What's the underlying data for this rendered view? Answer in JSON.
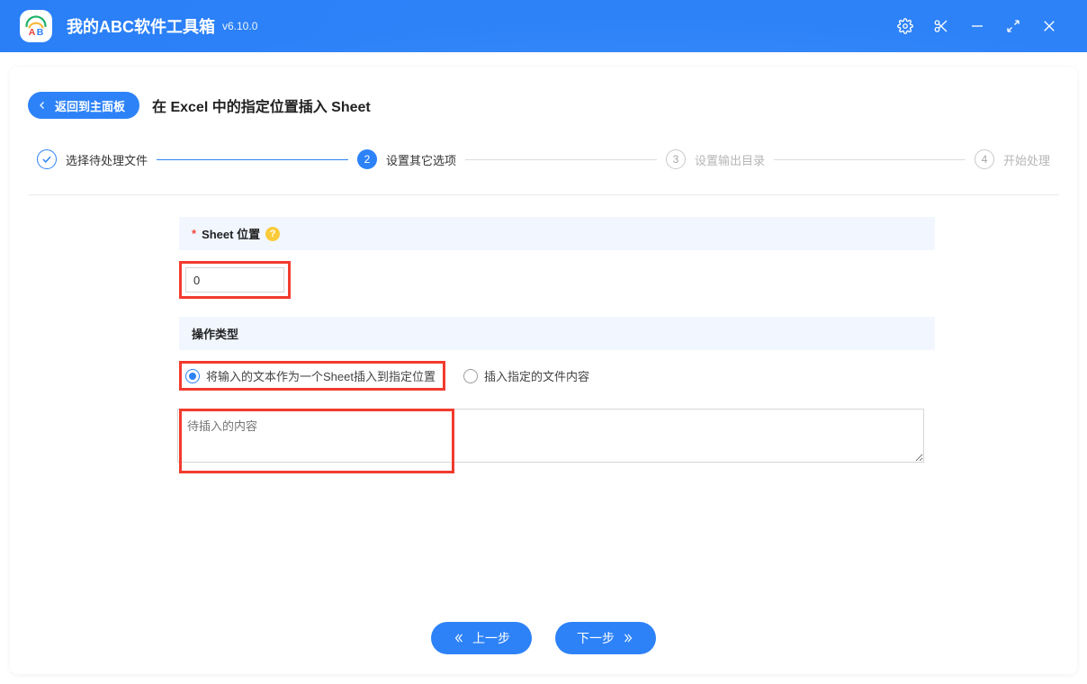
{
  "header": {
    "app_title": "我的ABC软件工具箱",
    "version": "v6.10.0"
  },
  "breadcrumb": {
    "back_label": "返回到主面板",
    "page_title": "在 Excel 中的指定位置插入 Sheet"
  },
  "stepper": {
    "steps": [
      {
        "label": "选择待处理文件",
        "status": "done"
      },
      {
        "label": "设置其它选项",
        "status": "current",
        "num": "2"
      },
      {
        "label": "设置输出目录",
        "status": "pending",
        "num": "3"
      },
      {
        "label": "开始处理",
        "status": "pending",
        "num": "4"
      }
    ]
  },
  "form": {
    "section1_label": "Sheet 位置",
    "required_marker": "*",
    "hint_icon": "?",
    "sheet_position_value": "0",
    "section2_label": "操作类型",
    "radio_options": [
      {
        "label": "将输入的文本作为一个Sheet插入到指定位置",
        "checked": true
      },
      {
        "label": "插入指定的文件内容",
        "checked": false
      }
    ],
    "textarea_placeholder": "待插入的内容",
    "textarea_value": ""
  },
  "footer": {
    "prev_label": "上一步",
    "next_label": "下一步"
  }
}
